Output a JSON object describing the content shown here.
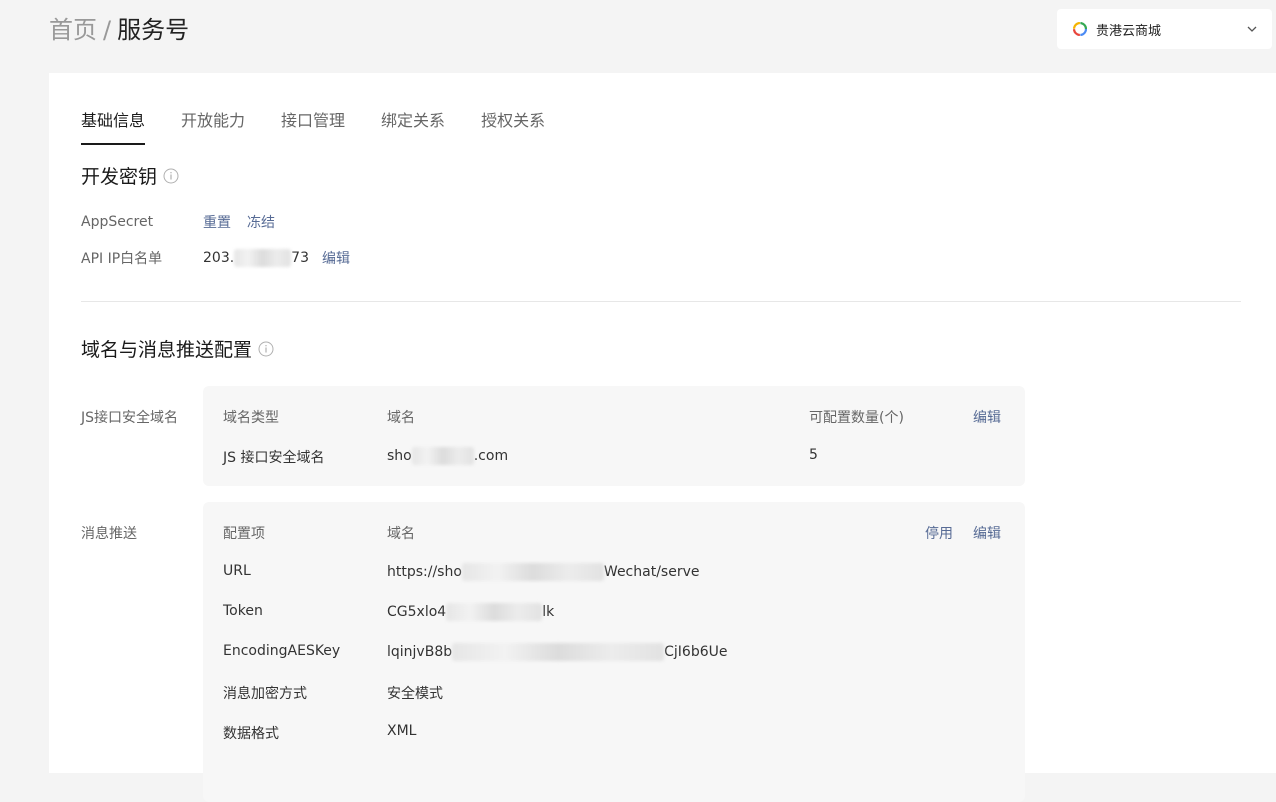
{
  "breadcrumb": {
    "home": "首页",
    "separator": "/",
    "current": "服务号"
  },
  "account": {
    "name": "贵港云商城"
  },
  "tabs": [
    "基础信息",
    "开放能力",
    "接口管理",
    "绑定关系",
    "授权关系"
  ],
  "dev_secret": {
    "title": "开发密钥",
    "appsecret_label": "AppSecret",
    "reset_link": "重置",
    "freeze_link": "冻结",
    "ip_label": "API IP白名单",
    "ip_prefix": "203.",
    "ip_suffix": "73",
    "edit_link": "编辑"
  },
  "domain_config": {
    "title": "域名与消息推送配置",
    "js_section": {
      "label": "JS接口安全域名",
      "headers": {
        "type": "域名类型",
        "domain": "域名",
        "count": "可配置数量(个)"
      },
      "edit_link": "编辑",
      "row": {
        "type": "JS 接口安全域名",
        "domain_prefix": "sho",
        "domain_suffix": ".com",
        "count": "5"
      }
    },
    "push_section": {
      "label": "消息推送",
      "headers": {
        "item": "配置项",
        "domain": "域名"
      },
      "disable_link": "停用",
      "edit_link": "编辑",
      "rows": [
        {
          "key": "URL",
          "prefix": "https://sho",
          "suffix": "Wechat/serve"
        },
        {
          "key": "Token",
          "prefix": "CG5xlo4",
          "suffix": "lk"
        },
        {
          "key": "EncodingAESKey",
          "prefix": "lqinjvB8b",
          "suffix": "CjI6b6Ue"
        },
        {
          "key": "消息加密方式",
          "prefix": "安全模式",
          "suffix": ""
        },
        {
          "key": "数据格式",
          "prefix": "XML",
          "suffix": ""
        }
      ]
    }
  },
  "colors": {
    "link": "#576b95",
    "background": "#f4f4f4",
    "card": "#f7f7f7"
  }
}
